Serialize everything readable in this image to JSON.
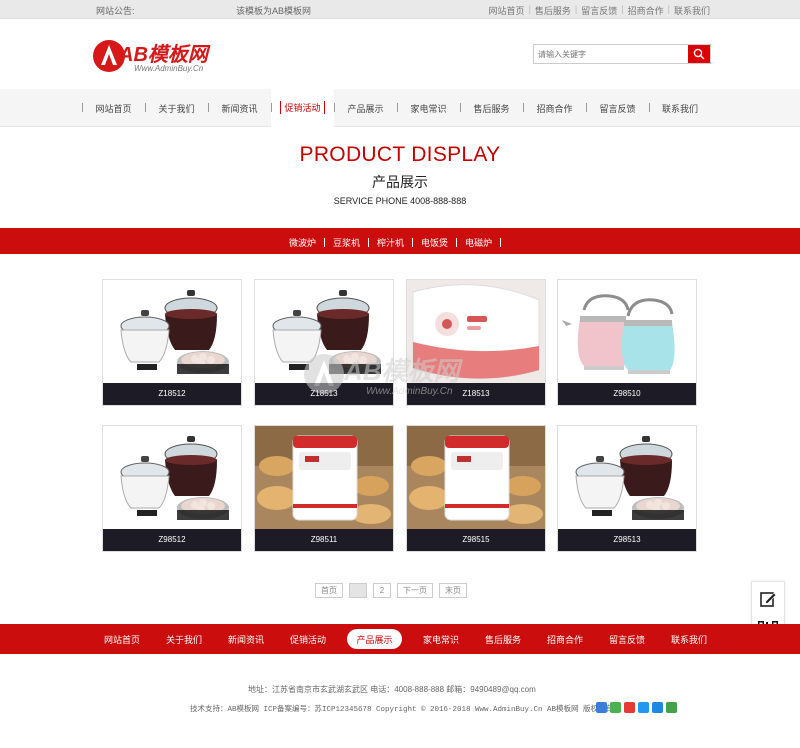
{
  "topbar": {
    "notice_label": "网站公告:",
    "notice_text": "该模板为AB模板网",
    "links": [
      "网站首页",
      "售后服务",
      "留言反馈",
      "招商合作",
      "联系我们"
    ]
  },
  "header": {
    "logo_main": "AB模板网",
    "logo_sub": "Www.AdminBuy.Cn",
    "search_placeholder": "请输入关键字"
  },
  "nav": {
    "items": [
      {
        "label": "网站首页",
        "active": false
      },
      {
        "label": "关于我们",
        "active": false
      },
      {
        "label": "新闻资讯",
        "active": false
      },
      {
        "label": "促销活动",
        "active": true
      },
      {
        "label": "产品展示",
        "active": false
      },
      {
        "label": "家电常识",
        "active": false
      },
      {
        "label": "售后服务",
        "active": false
      },
      {
        "label": "招商合作",
        "active": false
      },
      {
        "label": "留言反馈",
        "active": false
      },
      {
        "label": "联系我们",
        "active": false
      }
    ]
  },
  "page_title": {
    "en": "PRODUCT DISPLAY",
    "cn": "产品展示",
    "phone": "SERVICE PHONE 4008-888-888"
  },
  "categories": [
    "微波炉",
    "豆浆机",
    "榨汁机",
    "电饭煲",
    "电磁炉"
  ],
  "products": [
    {
      "name": "Z18512",
      "kind": "steamer"
    },
    {
      "name": "Z18513",
      "kind": "steamer"
    },
    {
      "name": "Z18513",
      "kind": "ricecooker"
    },
    {
      "name": "Z98510",
      "kind": "kettle"
    },
    {
      "name": "Z98512",
      "kind": "steamer"
    },
    {
      "name": "Z98511",
      "kind": "breadmaker"
    },
    {
      "name": "Z98515",
      "kind": "breadmaker"
    },
    {
      "name": "Z98513",
      "kind": "steamer"
    }
  ],
  "watermark": {
    "main": "AB模板网",
    "sub": "Www.AdminBuy.Cn"
  },
  "pager": {
    "first": "首页",
    "pages": [
      "1",
      "2"
    ],
    "current": "1",
    "next": "下一页",
    "last": "末页"
  },
  "footer_nav": {
    "items": [
      {
        "label": "网站首页",
        "active": false
      },
      {
        "label": "关于我们",
        "active": false
      },
      {
        "label": "新闻资讯",
        "active": false
      },
      {
        "label": "促销活动",
        "active": false
      },
      {
        "label": "产品展示",
        "active": true
      },
      {
        "label": "家电常识",
        "active": false
      },
      {
        "label": "售后服务",
        "active": false
      },
      {
        "label": "招商合作",
        "active": false
      },
      {
        "label": "留言反馈",
        "active": false
      },
      {
        "label": "联系我们",
        "active": false
      }
    ]
  },
  "footer": {
    "address_line": "地址：江苏省南京市玄武湖玄武区   电话：4008-888-888   邮箱：9490489@qq.com",
    "copyright_line": "技术支持：AB模板网   ICP备案编号：苏ICP12345678   Copyright © 2016-2018 Www.AdminBuy.Cn AB模板网 版权所有"
  },
  "colors": {
    "brand_red": "#cc0d0d",
    "caption_bg": "#1d1c26"
  },
  "icons": {
    "search": "search-icon",
    "edit": "edit-icon",
    "qr": "qr-code-icon"
  }
}
